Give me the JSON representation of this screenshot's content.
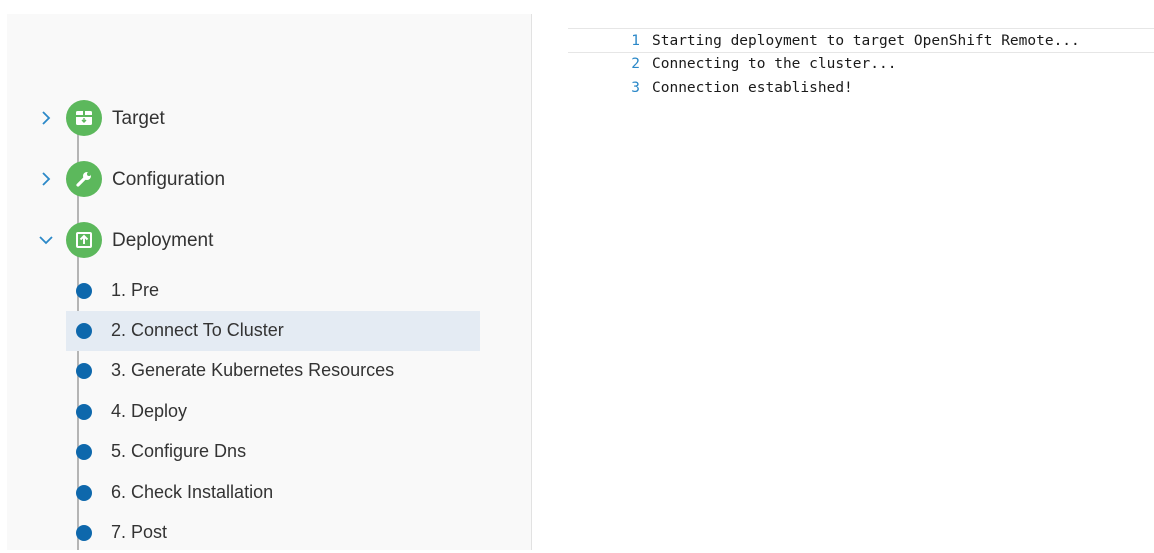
{
  "stages": [
    {
      "label": "Target",
      "icon": "target-box-icon",
      "expanded": false
    },
    {
      "label": "Configuration",
      "icon": "wrench-icon",
      "expanded": false
    },
    {
      "label": "Deployment",
      "icon": "upload-icon",
      "expanded": true
    }
  ],
  "deployment_steps": [
    {
      "label": "1. Pre"
    },
    {
      "label": "2. Connect To Cluster"
    },
    {
      "label": "3. Generate Kubernetes Resources"
    },
    {
      "label": "4. Deploy"
    },
    {
      "label": "5. Configure Dns"
    },
    {
      "label": "6. Check Installation"
    },
    {
      "label": "7. Post"
    }
  ],
  "selected_step": "2. Connect To Cluster",
  "log": [
    {
      "num": "1",
      "text": "Starting deployment to target OpenShift Remote..."
    },
    {
      "num": "2",
      "text": "Connecting to the cluster..."
    },
    {
      "num": "3",
      "text": "Connection established!"
    }
  ],
  "colors": {
    "stage_complete": "#5cb85c",
    "step_dot": "#0e68ac",
    "selected_row": "#e4ebf3",
    "chevron": "#2b88c8"
  }
}
